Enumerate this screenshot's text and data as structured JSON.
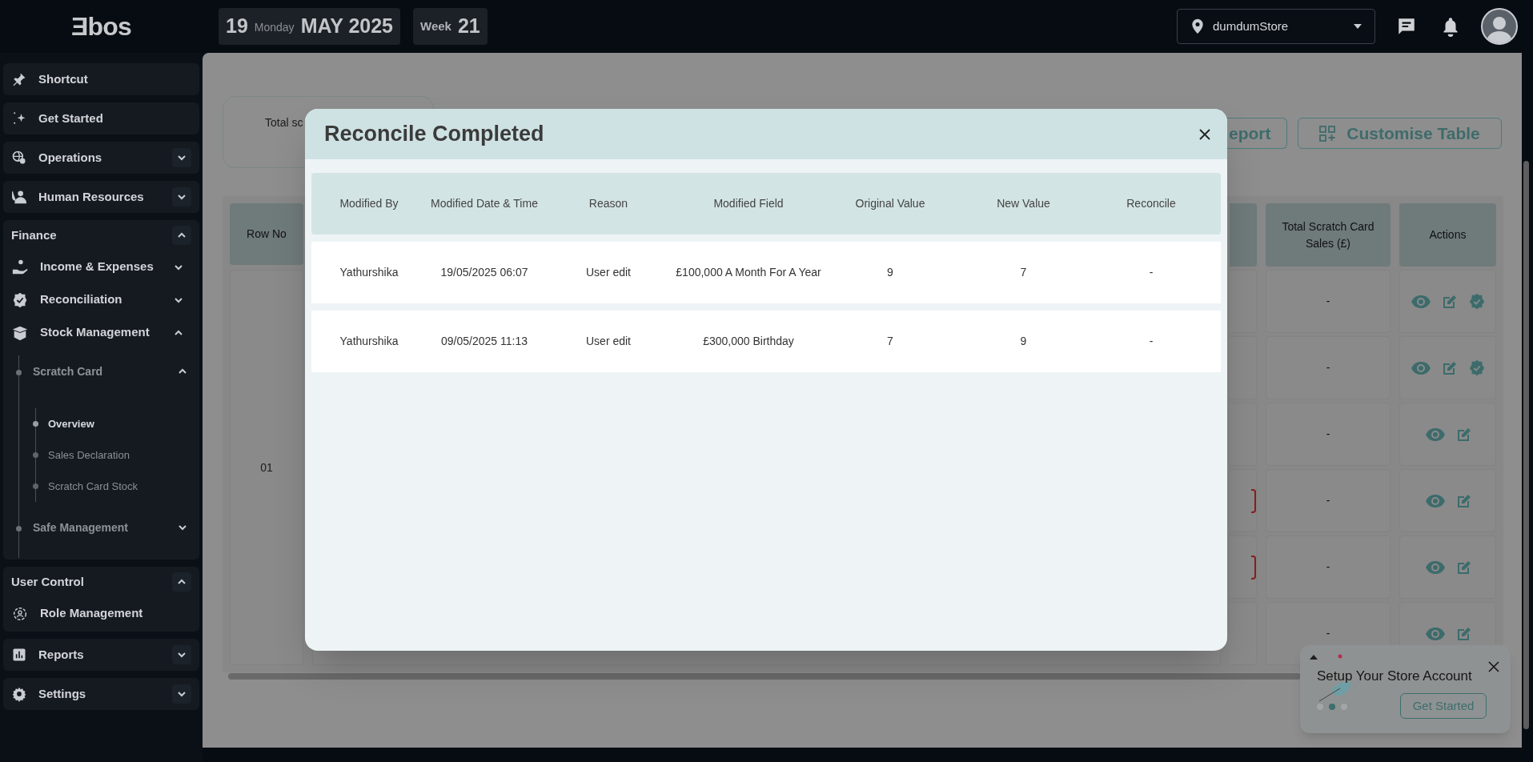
{
  "topbar": {
    "logo": "Ǝbos",
    "date": {
      "day": "19",
      "weekday": "Monday",
      "month_year": "MAY 2025"
    },
    "week": {
      "label": "Week",
      "number": "21"
    },
    "store_selector": {
      "value": "dumdumStore"
    }
  },
  "sidebar": {
    "items": [
      {
        "kind": "link",
        "label": "Shortcut"
      },
      {
        "kind": "link",
        "label": "Get Started"
      },
      {
        "kind": "collapsible",
        "label": "Operations",
        "expanded": false
      },
      {
        "kind": "collapsible",
        "label": "Human Resources",
        "expanded": false
      },
      {
        "kind": "group",
        "label": "Finance",
        "expanded": true,
        "children": [
          {
            "label": "Income & Expenses",
            "expanded": false
          },
          {
            "label": "Reconciliation",
            "expanded": false
          },
          {
            "label": "Stock Management",
            "expanded": true,
            "children": [
              {
                "label": "Scratch Card",
                "expanded": true,
                "children": [
                  {
                    "label": "Overview",
                    "selected": true
                  },
                  {
                    "label": "Sales Declaration",
                    "selected": false
                  },
                  {
                    "label": "Scratch Card Stock",
                    "selected": false
                  }
                ]
              },
              {
                "label": "Safe Management",
                "expanded": false
              }
            ]
          }
        ]
      },
      {
        "kind": "group",
        "label": "User Control",
        "expanded": true,
        "children": [
          {
            "label": "Role Management"
          }
        ]
      },
      {
        "kind": "collapsible",
        "label": "Reports",
        "expanded": false
      },
      {
        "kind": "collapsible",
        "label": "Settings",
        "expanded": false
      }
    ]
  },
  "page": {
    "summary_card": {
      "label": "Total sc"
    },
    "buttons": [
      {
        "label": "eport"
      },
      {
        "label": "Customise Table"
      }
    ],
    "table": {
      "row_no_header": "Row No",
      "row_no": "01",
      "total_header": "Total Scratch Card Sales (£)",
      "actions_header": "Actions",
      "rows": [
        {
          "total": "-",
          "flagged": false,
          "reconciled": true
        },
        {
          "total": "-",
          "flagged": false,
          "reconciled": true
        },
        {
          "total": "-",
          "flagged": false,
          "reconciled": false
        },
        {
          "total": "-",
          "flagged": true,
          "reconciled": false
        },
        {
          "total": "-",
          "flagged": true,
          "reconciled": false
        },
        {
          "total": "-",
          "flagged": false,
          "reconciled": false
        }
      ]
    }
  },
  "modal": {
    "title": "Reconcile Completed",
    "columns": [
      "Modified By",
      "Modified Date & Time",
      "Reason",
      "Modified Field",
      "Original Value",
      "New Value",
      "Reconcile"
    ],
    "rows": [
      [
        "Yathurshika",
        "19/05/2025 06:07",
        "User edit",
        "£100,000 A Month For A Year",
        "9",
        "7",
        "-"
      ],
      [
        "Yathurshika",
        "09/05/2025 11:13",
        "User edit",
        "£300,000 Birthday",
        "7",
        "9",
        "-"
      ]
    ]
  },
  "setup_popup": {
    "title": "Setup Your Store Account",
    "button": "Get Started",
    "steps": [
      {
        "selected": false
      },
      {
        "selected": true
      },
      {
        "selected": false
      }
    ]
  }
}
